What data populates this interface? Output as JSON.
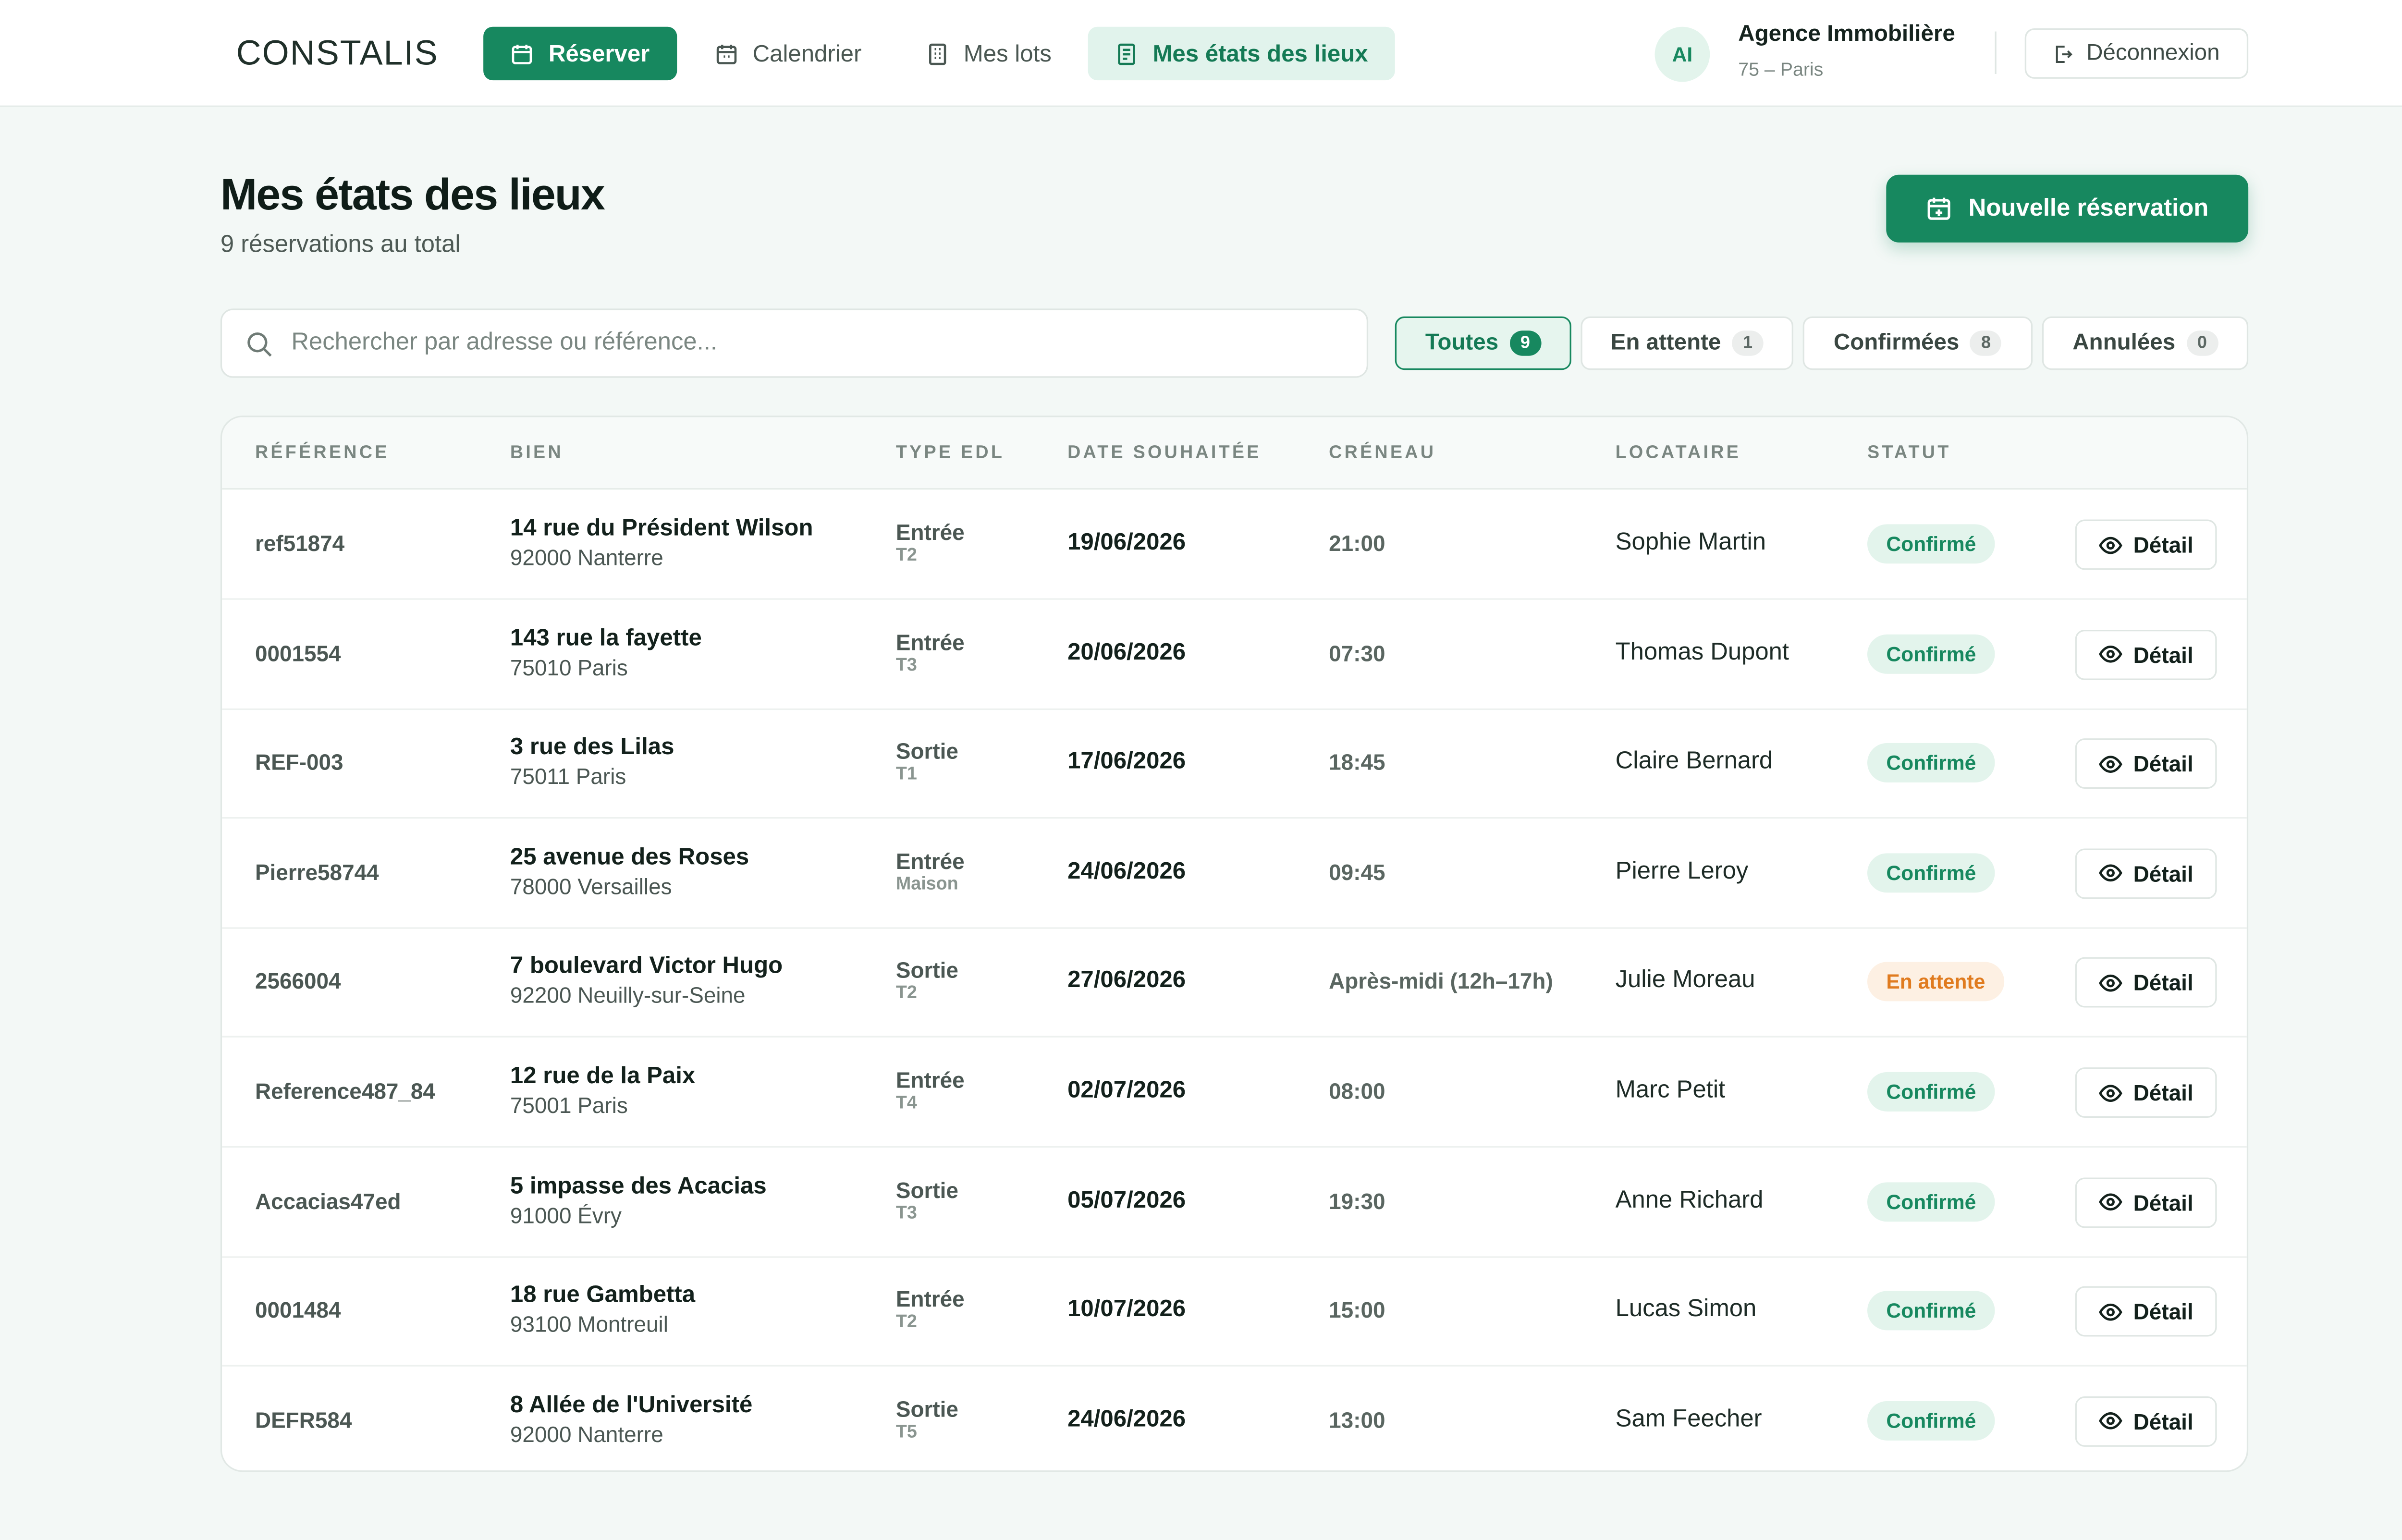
{
  "brand": {
    "logo_text": "CONSTALIS",
    "accent": "#17885f",
    "pending": "#e07b1f"
  },
  "nav": {
    "reserve": "Réserver",
    "calendar": "Calendrier",
    "lots": "Mes lots",
    "edl": "Mes états des lieux"
  },
  "user": {
    "initials": "AI",
    "name": "Agence Immobilière",
    "location": "75 – Paris",
    "logout": "Déconnexion"
  },
  "header": {
    "title": "Mes états des lieux",
    "subtitle": "9 réservations au total",
    "new_button": "Nouvelle réservation"
  },
  "search": {
    "placeholder": "Rechercher par adresse ou référence...",
    "value": ""
  },
  "filters": [
    {
      "label": "Toutes",
      "count": "9",
      "active": true
    },
    {
      "label": "En attente",
      "count": "1",
      "active": false
    },
    {
      "label": "Confirmées",
      "count": "8",
      "active": false
    },
    {
      "label": "Annulées",
      "count": "0",
      "active": false
    }
  ],
  "table": {
    "headers": [
      "RÉFÉRENCE",
      "BIEN",
      "TYPE EDL",
      "DATE SOUHAITÉE",
      "CRÉNEAU",
      "LOCATAIRE",
      "STATUT"
    ],
    "detail_label": "Détail",
    "rows": [
      {
        "ref": "ref51874",
        "address": "14 rue du Président Wilson",
        "city": "92000 Nanterre",
        "type": "Entrée",
        "kind": "T2",
        "date": "19/06/2026",
        "slot": "21:00",
        "tenant": "Sophie Martin",
        "status": "Confirmé",
        "status_type": "confirmed"
      },
      {
        "ref": "0001554",
        "address": "143 rue la fayette",
        "city": "75010 Paris",
        "type": "Entrée",
        "kind": "T3",
        "date": "20/06/2026",
        "slot": "07:30",
        "tenant": "Thomas Dupont",
        "status": "Confirmé",
        "status_type": "confirmed"
      },
      {
        "ref": "REF-003",
        "address": "3 rue des Lilas",
        "city": "75011 Paris",
        "type": "Sortie",
        "kind": "T1",
        "date": "17/06/2026",
        "slot": "18:45",
        "tenant": "Claire Bernard",
        "status": "Confirmé",
        "status_type": "confirmed"
      },
      {
        "ref": "Pierre58744",
        "address": "25 avenue des Roses",
        "city": "78000 Versailles",
        "type": "Entrée",
        "kind": "Maison",
        "date": "24/06/2026",
        "slot": "09:45",
        "tenant": "Pierre Leroy",
        "status": "Confirmé",
        "status_type": "confirmed"
      },
      {
        "ref": "2566004",
        "address": "7 boulevard Victor Hugo",
        "city": "92200 Neuilly-sur-Seine",
        "type": "Sortie",
        "kind": "T2",
        "date": "27/06/2026",
        "slot": "Après-midi (12h–17h)",
        "tenant": "Julie Moreau",
        "status": "En attente",
        "status_type": "pending"
      },
      {
        "ref": "Reference487_84",
        "address": "12 rue de la Paix",
        "city": "75001 Paris",
        "type": "Entrée",
        "kind": "T4",
        "date": "02/07/2026",
        "slot": "08:00",
        "tenant": "Marc Petit",
        "status": "Confirmé",
        "status_type": "confirmed"
      },
      {
        "ref": "Accacias47ed",
        "address": "5 impasse des Acacias",
        "city": "91000 Évry",
        "type": "Sortie",
        "kind": "T3",
        "date": "05/07/2026",
        "slot": "19:30",
        "tenant": "Anne Richard",
        "status": "Confirmé",
        "status_type": "confirmed"
      },
      {
        "ref": "0001484",
        "address": "18 rue Gambetta",
        "city": "93100 Montreuil",
        "type": "Entrée",
        "kind": "T2",
        "date": "10/07/2026",
        "slot": "15:00",
        "tenant": "Lucas Simon",
        "status": "Confirmé",
        "status_type": "confirmed"
      },
      {
        "ref": "DEFR584",
        "address": "8 Allée de l'Université",
        "city": "92000 Nanterre",
        "type": "Sortie",
        "kind": "T5",
        "date": "24/06/2026",
        "slot": "13:00",
        "tenant": "Sam Feecher",
        "status": "Confirmé",
        "status_type": "confirmed"
      }
    ]
  }
}
